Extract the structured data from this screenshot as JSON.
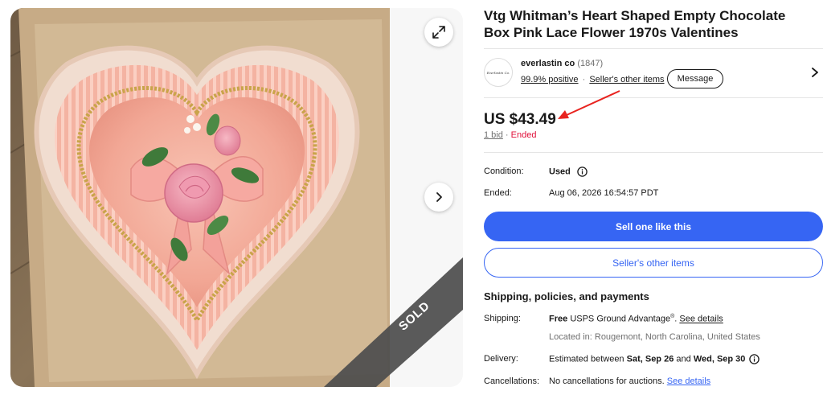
{
  "listing": {
    "title": "Vtg Whitman’s Heart Shaped Empty Chocolate Box Pink Lace Flower 1970s Valentines",
    "sold_overlay": "SOLD"
  },
  "seller": {
    "name": "everlastin co",
    "feedback_count": "(1847)",
    "positive": "99.9% positive",
    "dot": "·",
    "other_items_link": "Seller's other items",
    "message_button": "Message",
    "avatar_text": "Everlastin Co."
  },
  "price": {
    "amount": "US $43.49",
    "bids": "1 bid",
    "separator": "·",
    "status": "Ended"
  },
  "attributes": {
    "condition_label": "Condition:",
    "condition_value": "Used",
    "ended_label": "Ended:",
    "ended_value": "Aug 06, 2026 16:54:57 PDT"
  },
  "buttons": {
    "sell_one": "Sell one like this",
    "sellers_other_items": "Seller's other items"
  },
  "shipping": {
    "heading": "Shipping, policies, and payments",
    "shipping_label": "Shipping:",
    "shipping_free": "Free",
    "shipping_service": "USPS Ground Advantage",
    "shipping_reg": "®",
    "shipping_period": ".",
    "see_details": "See details",
    "location": "Located in: Rougemont, North Carolina, United States",
    "delivery_label": "Delivery:",
    "delivery_prefix": "Estimated between",
    "delivery_start": "Sat, Sep 26",
    "delivery_and": "and",
    "delivery_end": "Wed, Sep 30",
    "cancellations_label": "Cancellations:",
    "cancellations_value": "No cancellations for auctions.",
    "cancellations_link": "See details"
  },
  "colors": {
    "accent_blue": "#3665f3",
    "ended_red": "#e0103a",
    "annotation_arrow": "#e8231f"
  }
}
